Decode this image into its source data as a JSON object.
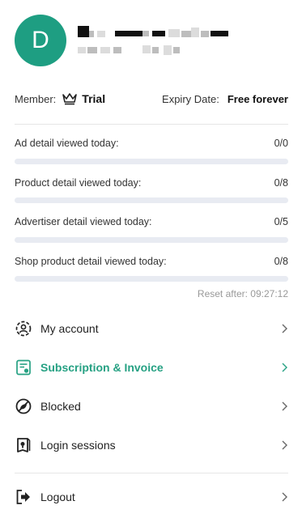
{
  "profile": {
    "avatar_letter": "D",
    "colors": {
      "avatar_bg": "#1e9e82",
      "accent": "#26a183"
    }
  },
  "membership": {
    "member_label": "Member:",
    "plan": "Trial",
    "plan_icon": "crown-icon",
    "expiry_label": "Expiry Date:",
    "expiry_value": "Free forever"
  },
  "usage": [
    {
      "label": "Ad detail viewed today:",
      "count": "0/0",
      "progress": 0
    },
    {
      "label": "Product detail viewed today:",
      "count": "0/8",
      "progress": 0
    },
    {
      "label": "Advertiser detail viewed today:",
      "count": "0/5",
      "progress": 0
    },
    {
      "label": "Shop product detail viewed today:",
      "count": "0/8",
      "progress": 0
    }
  ],
  "reset": "Reset after: 09:27:12",
  "menu": [
    {
      "label": "My account",
      "icon": "account-gear-icon"
    },
    {
      "label": "Subscription & Invoice",
      "icon": "subscription-invoice-icon",
      "active": true
    },
    {
      "label": "Blocked",
      "icon": "blocked-icon"
    },
    {
      "label": "Login sessions",
      "icon": "login-sessions-icon"
    },
    {
      "label": "Logout",
      "icon": "logout-icon"
    }
  ]
}
